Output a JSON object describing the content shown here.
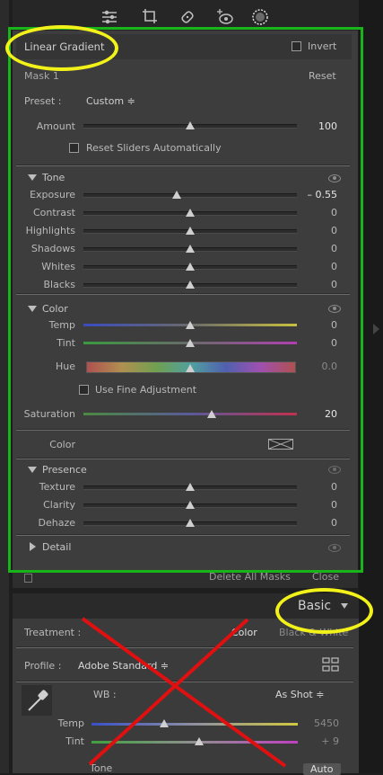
{
  "toolbar": {
    "icons": [
      "sliders-icon",
      "crop-icon",
      "heal-icon",
      "redeye-icon",
      "mask-icon"
    ]
  },
  "panel": {
    "title": "Linear Gradient",
    "invert_label": "Invert",
    "mask_label": "Mask 1",
    "reset_label": "Reset",
    "preset_label": "Preset :",
    "preset_value": "Custom ≑",
    "amount": {
      "label": "Amount",
      "value": "100",
      "level": 0.5
    },
    "reset_sliders_label": "Reset Sliders Automatically"
  },
  "tone": {
    "header": "Tone",
    "sliders": [
      {
        "label": "Exposure",
        "value": "– 0.55",
        "level": 0.435
      },
      {
        "label": "Contrast",
        "value": "0",
        "level": 0.5
      },
      {
        "label": "Highlights",
        "value": "0",
        "level": 0.5
      },
      {
        "label": "Shadows",
        "value": "0",
        "level": 0.5
      },
      {
        "label": "Whites",
        "value": "0",
        "level": 0.5
      },
      {
        "label": "Blacks",
        "value": "0",
        "level": 0.5
      }
    ]
  },
  "color": {
    "header": "Color",
    "temp": {
      "label": "Temp",
      "value": "0",
      "level": 0.5
    },
    "tint": {
      "label": "Tint",
      "value": "0",
      "level": 0.5
    },
    "hue": {
      "label": "Hue",
      "value": "0.0",
      "level": 0.5
    },
    "fine_label": "Use Fine Adjustment",
    "saturation": {
      "label": "Saturation",
      "value": "20",
      "level": 0.6
    },
    "color_label": "Color"
  },
  "presence": {
    "header": "Presence",
    "sliders": [
      {
        "label": "Texture",
        "value": "0",
        "level": 0.5
      },
      {
        "label": "Clarity",
        "value": "0",
        "level": 0.5
      },
      {
        "label": "Dehaze",
        "value": "0",
        "level": 0.5
      }
    ]
  },
  "detail": {
    "header": "Detail"
  },
  "footer": {
    "delete_label": "Delete All Masks",
    "close_label": "Close"
  },
  "basic": {
    "title": "Basic",
    "treatment_label": "Treatment :",
    "color_option": "Color",
    "bw_option": "Black & White",
    "profile_label": "Profile :",
    "profile_value": "Adobe Standard ≑",
    "wb_label": "WB :",
    "wb_value": "As Shot ≑",
    "temp": {
      "label": "Temp",
      "value": "5450",
      "level": 0.35
    },
    "tint": {
      "label": "Tint",
      "value": "+ 9",
      "level": 0.52
    },
    "tone_label": "Tone",
    "auto_label": "Auto"
  },
  "colors": {
    "annotation_green": "#19b31a",
    "annotation_yellow": "#f2f21a",
    "annotation_red": "#e01010"
  }
}
